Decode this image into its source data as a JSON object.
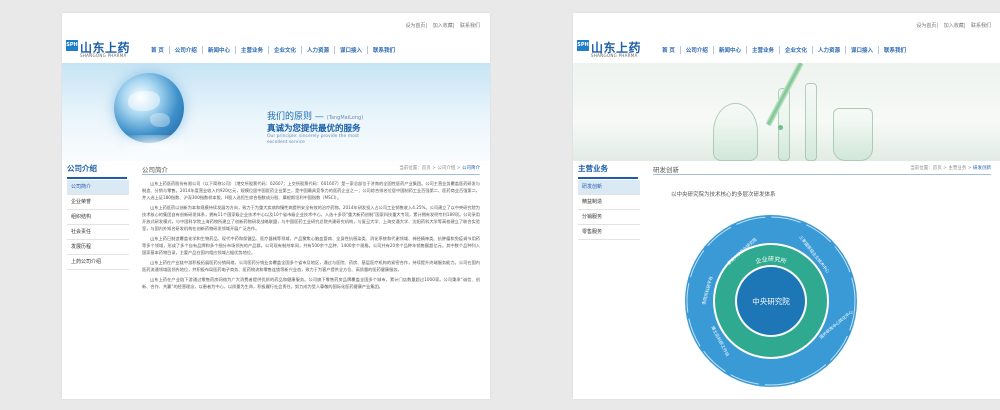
{
  "left": {
    "toplinks": [
      "设为首页",
      "加入收藏",
      "联系我们"
    ],
    "logo": {
      "mark": "SPH",
      "name": "山东上药",
      "en": "SHANGONG PHARMA"
    },
    "nav": [
      "首  页",
      "公司介绍",
      "新闻中心",
      "主营业务",
      "企业文化",
      "人力资源",
      "谋口接入",
      "联系我们"
    ],
    "banner": {
      "slogan_main": "我们的原则 —",
      "slogan_pinyin": "(TangMaiLong)",
      "slogan_sub": "真诚为您提供最优的服务",
      "slogan_en": "Our principle: sincerely provide the most excellent service"
    },
    "sidebar": {
      "title": "公司介绍",
      "items": [
        "公司简介",
        "企业荣誉",
        "组织结构",
        "社会责任",
        "发展历程",
        "上药公司介绍"
      ],
      "active_index": 0
    },
    "content": {
      "title": "公司简介",
      "breadcrumb_prefix": "当前位置：首页 > 公司介绍 >",
      "breadcrumb_current": "公司简介",
      "paragraphs": [
        "山东上药医药股份有限公司（以下简称公司）（港交所股票代码：02607；上交所股票代码：601607）是一家总部位于济南的全国性医药产业集团。公司主营业务覆盖医药研发与制造、分销与零售。2014年度营业收入约920亿元，规模位居中国医药企业第三，是中国最具竞争力的医药企业之一；公司综合排名位居中国制药工业百强第二、医药商业百强第二，并入选上证180指数、沪深300指数样本股，H股入选恒生综合指数成分股、摩根斯坦利中国指数（MSCI）。",
        "山东上药医药以创新为本和规模持续发展为方向，致力于为重大疾病和慢性病提供安全有效的治疗药物。2014年研发投入占公司工业销售收入4.25%。公司建立了以中央研究院为技术核心的集团自有创新研发体系，拥有11个国家级企业技术中心以及10个省市级企业技术中心，入选十多项“重大新药创制”国家科技重大专项，累计拥有发明专利189项。公司采用开放式研发模式，与中国科学院上海药物所建立了创新药物研发战略联盟，与中国医药工业研究总院共建研究机构，与复旦大学、上海交通大学、沈阳药科大学等高校建立了联合实验室，与国内外知名研发机构在创新药物研发领域开展广泛合作。",
        "山东上药已制造覆盖化学和生物药品、现代中药和保健品、医疗器械等领域，产品聚焦心脑血管病、全身性抗感染类、消化系统和代谢领域、神经精神类、抗肿瘤和免疫调节用药等多个领域，形成了多个自有品牌和多个细分市场领先的产品群。公司现有制剂车间，共有500余个品种、1400余个规格。公司共有20余个品种年销售额超亿元，其中数个品种列入国家基本药物目录，主要产品在国内相应领域占据优势地位。",
        "山东上药在产业链中游积极拓展医药分销网络，公司医药分销业务覆盖全国多个省市及地区，通过与医院、药房、基层医疗机构的紧密合作，持续提升终端服务能力。公司在国内医药流通领域居领先地位，并积极布局医药电子商务、医药物流和零售连锁等新兴业态，致力于为客户提供全方位、高质量的医药健康服务。",
        "山东上药在产业链下游通过零售药房网络为广大消费者提供优质的药品和健康服务。公司旗下零售药房品牌覆盖全国多个城市，累计门店数量超过1000家。公司秉承“诚信、创新、合作、共赢”的经营理念，以患者为中心，以质量为生命，积极履行社会责任，努力成为受人尊敬的国际化医药健康产业集团。"
      ]
    }
  },
  "right": {
    "toplinks": [
      "设为首页",
      "加入收藏",
      "联系我们"
    ],
    "logo": {
      "mark": "SPH",
      "name": "山东上药",
      "en": "SHANGONG PHARMA"
    },
    "nav": [
      "首  页",
      "公司介绍",
      "新闻中心",
      "主营业务",
      "企业文化",
      "人力资源",
      "谋口接入",
      "联系我们"
    ],
    "sidebar": {
      "title": "主营业务",
      "items": [
        "研发创新",
        "精益制造",
        "分销服务",
        "零售服务"
      ],
      "active_index": 0
    },
    "content": {
      "title": "研发创新",
      "breadcrumb_prefix": "当前位置：首页 > 主营业务 >",
      "breadcrumb_current": "研发创新",
      "intro": "以中央研究院为技术核心的多层次研发体系",
      "diagram": {
        "center": "中央研究院",
        "middle": "企业研究所",
        "outer": [
          "复旦大学联合研究院",
          "三家国家级企业技术中心",
          "国外研发中心转化中心",
          "各院所科研平台",
          "博士后科研工作站"
        ]
      }
    }
  }
}
